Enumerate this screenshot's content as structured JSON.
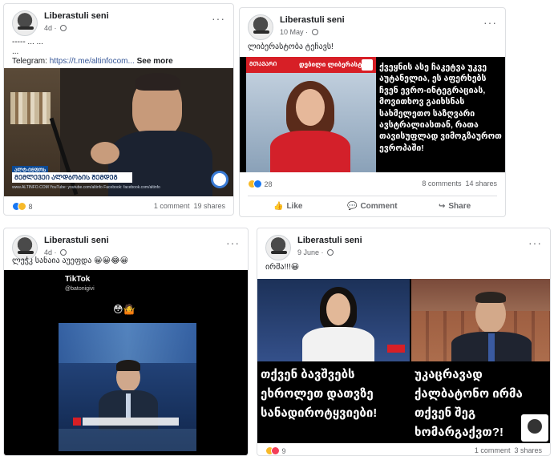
{
  "posts": [
    {
      "author": "Liberastuli seni",
      "date": "4d",
      "text": "----- ... ...",
      "text2": "...",
      "telegram_label": "Telegram: ",
      "telegram_link": "https://t.me/altinfocom...",
      "see_more": "See more",
      "video_strip_left": "ᲐᲚᲢ-ᲘᲜᲤᲝᲡ",
      "video_title": "ᲛᲔᲛᲚᲔᲕᲔᲘ ᲐᲚᲓᲑᲝᲑᲘᲡ ᲨᲔᲛᲓᲔᲒ",
      "video_bottom": "www.ALTINFO.COM   YouTube: youtube.com/altinfo   Facebook: facebook.com/altinfo",
      "reaction_count": "8",
      "comments": "1 comment",
      "shares": "19 shares"
    },
    {
      "author": "Liberastuli seni",
      "date": "10 May",
      "text": "ლიბერასტობა ტეჩავს!",
      "tv_label": "ᲛᲗᲐᲕᲐᲠᲘ",
      "tv_banner": "დებილი ლიბერასტი",
      "caption": "ქვეყნის ასე ჩაკეტვა უკვე აუტანელია, ეს აფერხებს ჩვენ ევრო-ინტეგრაციას, მოვითხოვ გაიხსნას სახმელეთო საზღვარი ავსტრალიასთან, რათა თავისუფლად ვიმოგზაუროთ ევროპაში!",
      "reaction_count": "28",
      "comments": "8 comments",
      "shares": "14 shares",
      "actions": {
        "like": "Like",
        "comment": "Comment",
        "share": "Share"
      }
    },
    {
      "author": "Liberastuli seni",
      "date": "4d",
      "text": "ლეჭკ სანაია აუეფდა 😀😀😂😀",
      "tiktok_label": "TikTok",
      "tiktok_user": "@batonigivi",
      "emoji_row": "😳🤷"
    },
    {
      "author": "Liberastuli seni",
      "date": "9 June",
      "text": "ირმა!!!😀",
      "left_caption": "თქვენ ბავშვებს ეხროლეთ დათვზე სანადიროტყვიები!",
      "right_caption": "უკაცრავად ქალბატონო ირმა თქვენ შეგ ხომარგაქვთ?!",
      "reaction_count": "9",
      "comments": "1 comment",
      "shares": "3 shares"
    }
  ],
  "colors": {
    "tv_red": "#d71f26",
    "fb_blue": "#1877f2",
    "link": "#385898"
  }
}
